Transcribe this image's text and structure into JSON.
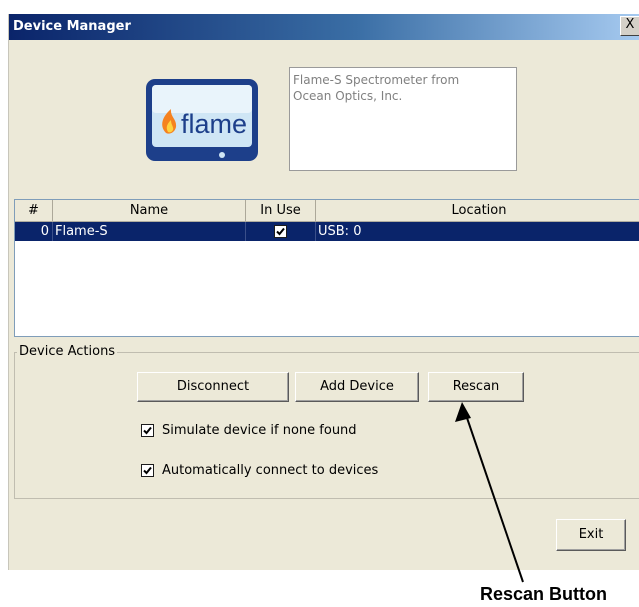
{
  "window": {
    "title": "Device Manager",
    "close_label": "X"
  },
  "logo": {
    "text": "flame"
  },
  "description": "Flame-S Spectrometer from\nOcean Optics, Inc.",
  "device_list": {
    "columns": [
      "#",
      "Name",
      "In Use",
      "Location"
    ],
    "rows": [
      {
        "num": "0",
        "name": "Flame-S",
        "in_use": true,
        "location": "USB: 0"
      }
    ]
  },
  "device_actions": {
    "label": "Device Actions",
    "buttons": {
      "disconnect": "Disconnect",
      "add_device": "Add Device",
      "rescan": "Rescan"
    },
    "options": {
      "simulate": {
        "label": "Simulate device if none found",
        "checked": true
      },
      "auto_connect": {
        "label": "Automatically connect to devices",
        "checked": true
      }
    }
  },
  "exit_label": "Exit",
  "annotation": {
    "text": "Rescan Button"
  },
  "colors": {
    "selection": "#0a246a",
    "dialog_bg": "#ece9d8",
    "title_start": "#0a246a",
    "title_end": "#a6caf0"
  }
}
